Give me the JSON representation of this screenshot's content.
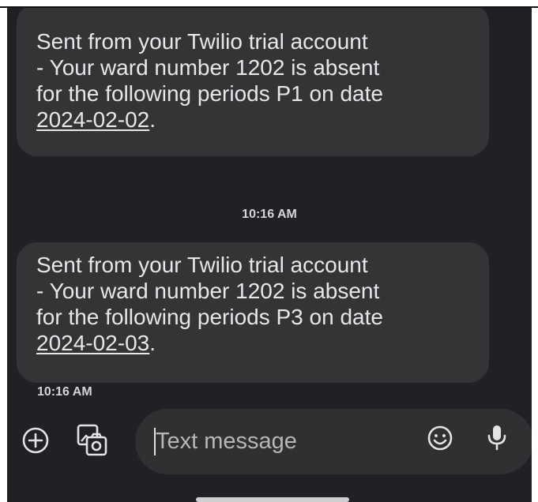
{
  "messages": [
    {
      "lines": [
        "Sent from your Twilio trial account",
        "- Your ward number 1202 is absent",
        "for the following periods P1 on date"
      ],
      "date_link": "2024-02-02",
      "end_punct": "."
    },
    {
      "lines": [
        "Sent from your Twilio trial account",
        "- Your ward number 1202 is absent",
        "for the following periods P3 on date"
      ],
      "date_link": "2024-02-03",
      "end_punct": "."
    }
  ],
  "timestamps": [
    "10:16 AM",
    "10:16 AM"
  ],
  "composer": {
    "placeholder": "Text message",
    "icons": [
      "add-icon",
      "gallery-icon",
      "emoji-icon",
      "mic-icon"
    ]
  },
  "colors": {
    "background": "#202124",
    "bubble": "#343437",
    "input": "#303033",
    "text": "#e7e7ea"
  }
}
